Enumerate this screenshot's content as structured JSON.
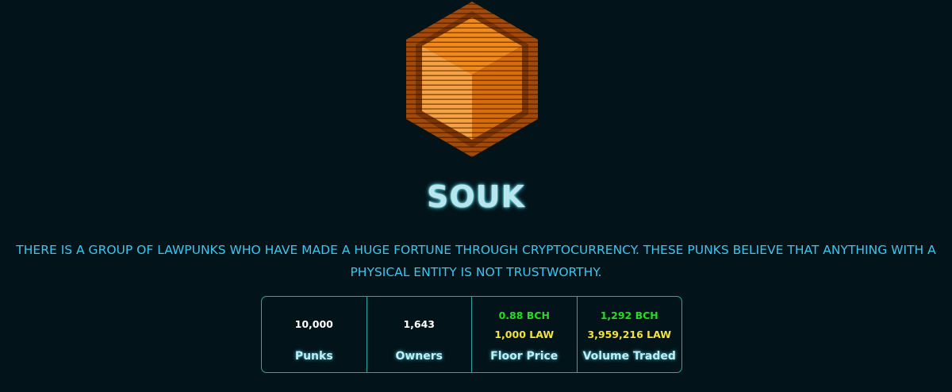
{
  "header": {
    "logo_icon": "orange-hexagon-cube-icon",
    "title": "SOUK",
    "description": "THERE IS A GROUP OF LAWPUNKS WHO HAVE MADE A HUGE FORTUNE THROUGH CRYPTOCURRENCY. THESE PUNKS BELIEVE THAT ANYTHING WITH A PHYSICAL ENTITY IS NOT TRUSTWORTHY."
  },
  "stats": {
    "punks": {
      "value": "10,000",
      "label": "Punks"
    },
    "owners": {
      "value": "1,643",
      "label": "Owners"
    },
    "floor_price": {
      "bch": "0.88 BCH",
      "law": "1,000 LAW",
      "label": "Floor Price"
    },
    "volume_traded": {
      "bch": "1,292 BCH",
      "law": "3,959,216 LAW",
      "label": "Volume Traded"
    }
  },
  "colors": {
    "background": "#02141a",
    "title_glow": "#5fd6ea",
    "description": "#3fc4ec",
    "border": "#2fa6a0",
    "bch_green": "#22dd22",
    "law_yellow": "#f2e23a",
    "logo_orange": "#e07a10"
  }
}
